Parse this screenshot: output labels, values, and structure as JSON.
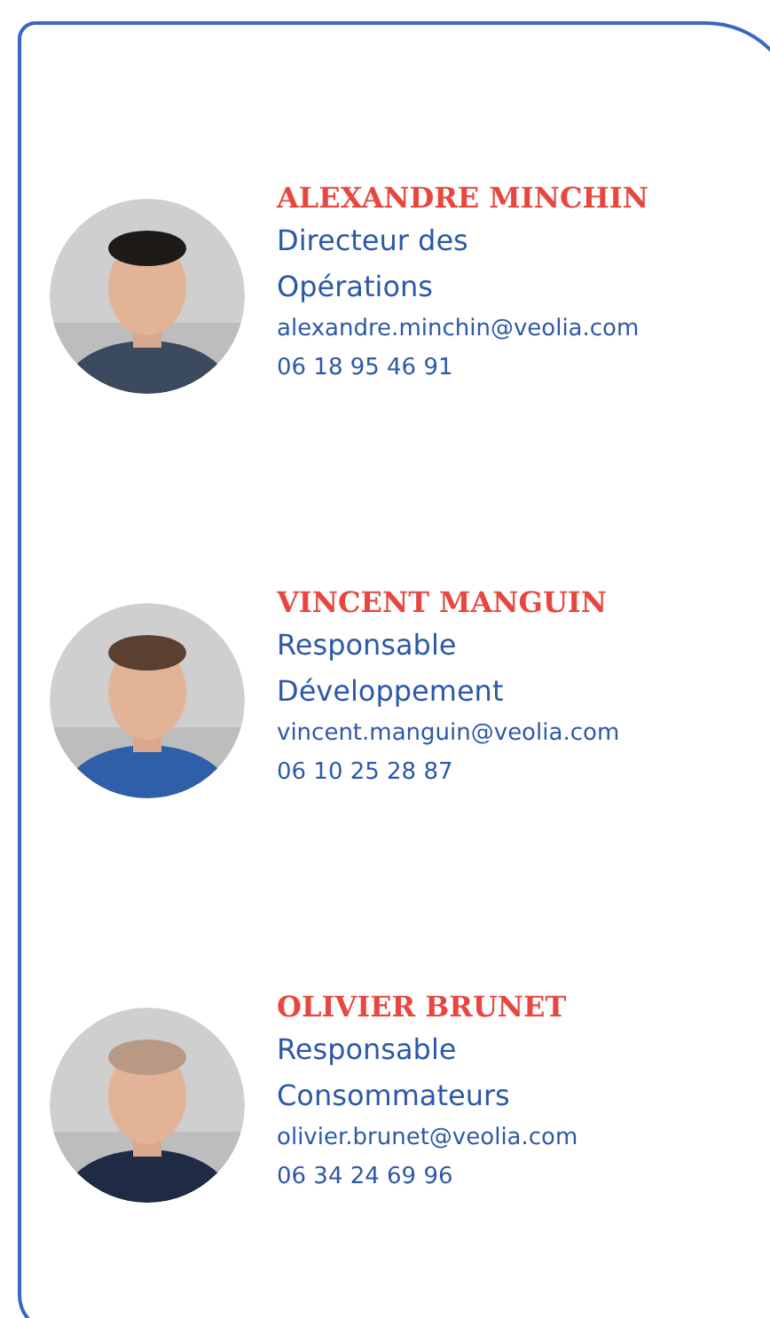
{
  "contacts": [
    {
      "name": "ALEXANDRE MINCHIN",
      "role": "Directeur des Opérations",
      "email": "alexandre.minchin@veolia.com",
      "phone": "06 18 95 46 91"
    },
    {
      "name": "VINCENT MANGUIN",
      "role": "Responsable Développement",
      "email": "vincent.manguin@veolia.com",
      "phone": "06 10 25 28 87"
    },
    {
      "name": "OLIVIER BRUNET",
      "role": "Responsable Consommateurs",
      "email": "olivier.brunet@veolia.com",
      "phone": "06 34 24 69 96"
    }
  ]
}
